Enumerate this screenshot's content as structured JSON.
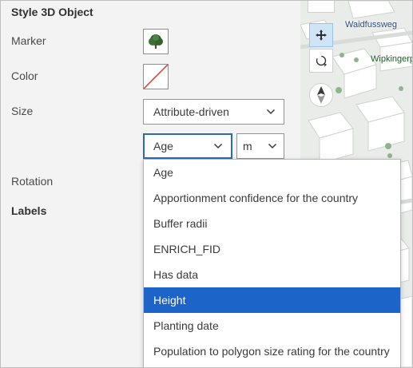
{
  "panel": {
    "title": "Style 3D Object",
    "rows": {
      "marker": "Marker",
      "color": "Color",
      "size": "Size",
      "rotation": "Rotation"
    },
    "labels_heading": "Labels"
  },
  "size_select": {
    "value": "Attribute-driven"
  },
  "field_select": {
    "value": "Age"
  },
  "unit_select": {
    "value": "m"
  },
  "dropdown": {
    "options": [
      "Age",
      "Apportionment confidence for the country",
      "Buffer radii",
      "ENRICH_FID",
      "Has data",
      "Height",
      "Planting date",
      "Population to polygon size rating for the country"
    ],
    "selected": "Height"
  },
  "map": {
    "labels": [
      "Waidfussweg",
      "Wipkingerp"
    ],
    "controls": [
      "pan-icon",
      "rotate-icon",
      "compass-icon"
    ]
  },
  "colors": {
    "accent": "#1d64c8",
    "panel_bg": "#f3f3f3",
    "focus_border": "#2b6cb0"
  }
}
